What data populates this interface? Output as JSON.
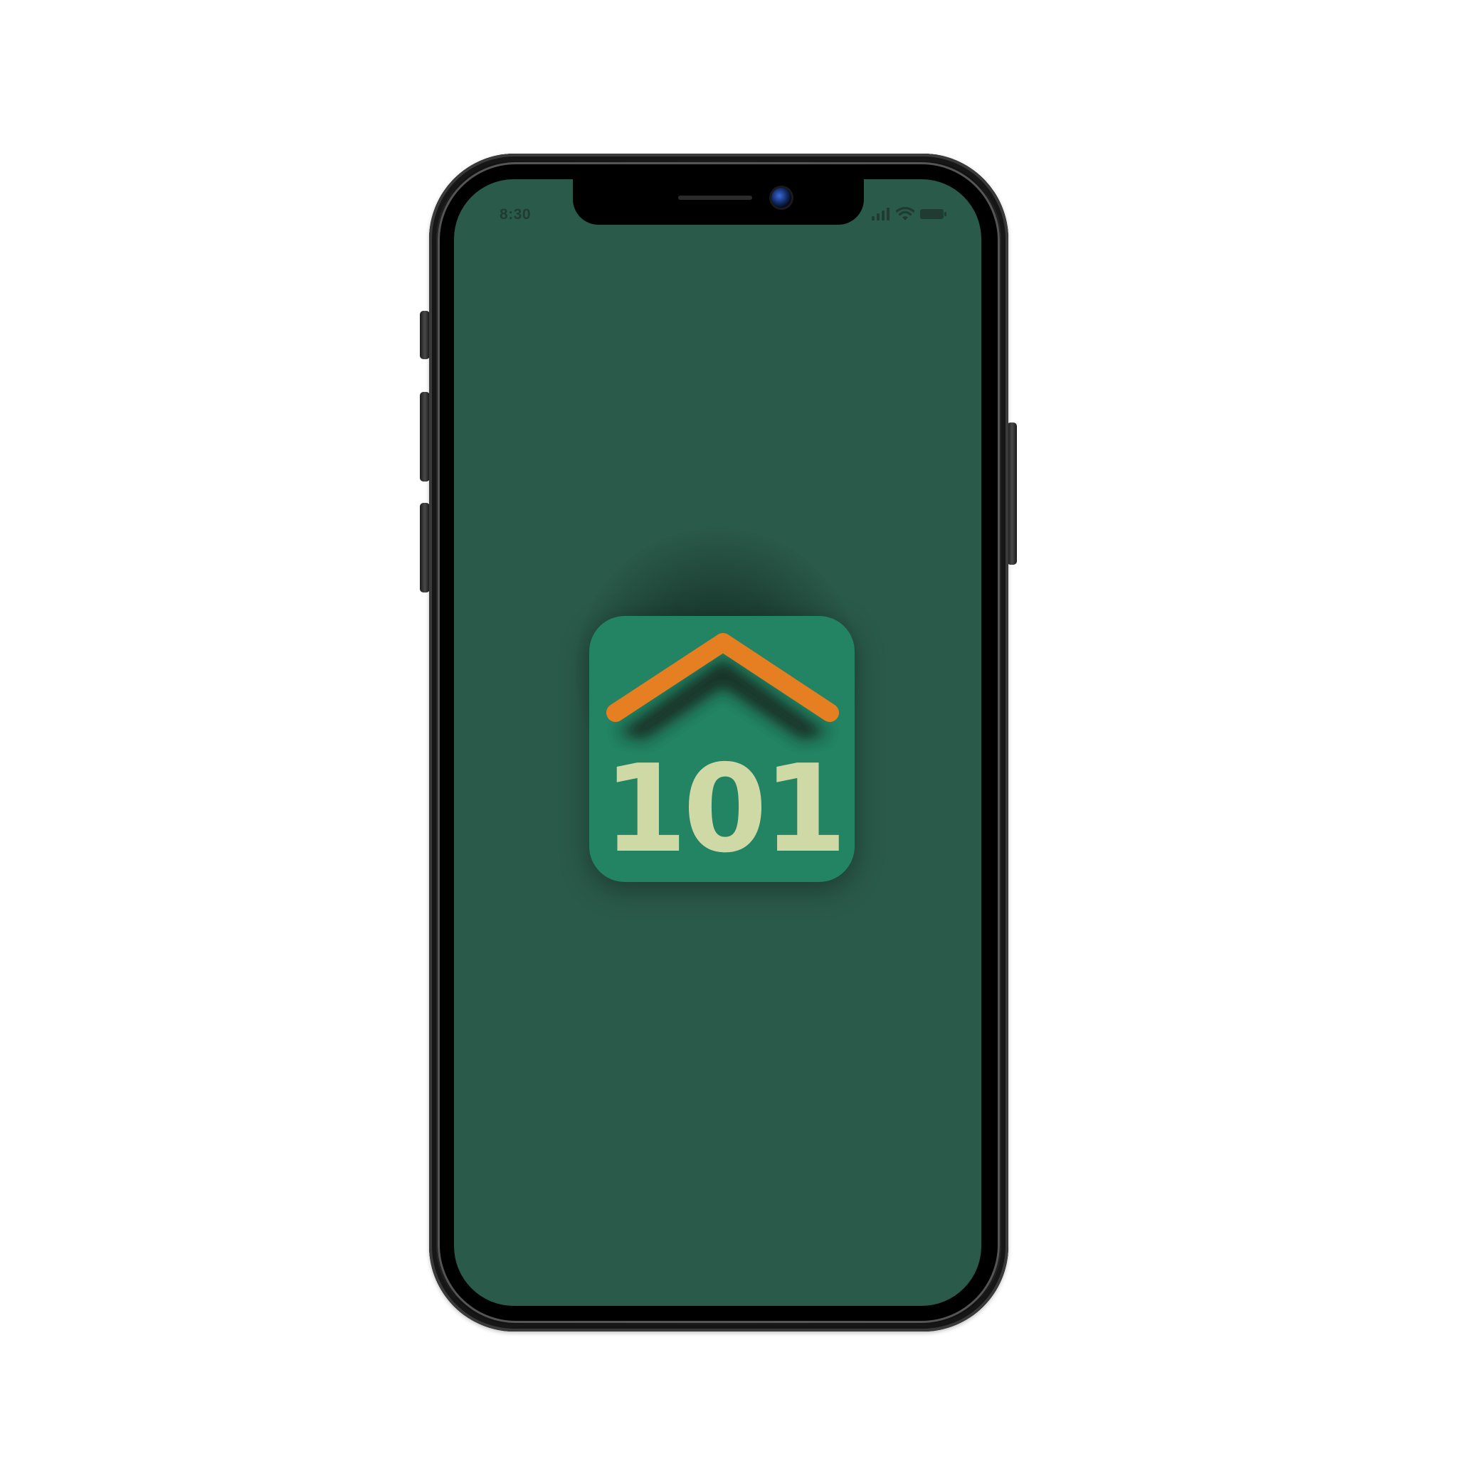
{
  "status_bar": {
    "time": "8:30",
    "icons": [
      "signal-icon",
      "wifi-icon",
      "battery-icon"
    ],
    "text_color": "#1f3b32"
  },
  "screen": {
    "background": "#2a5a4a"
  },
  "app_icon": {
    "logo_text": "101",
    "tile_color": "#228463",
    "roof_color": "#e67e22",
    "text_color": "#cfd9a6"
  }
}
